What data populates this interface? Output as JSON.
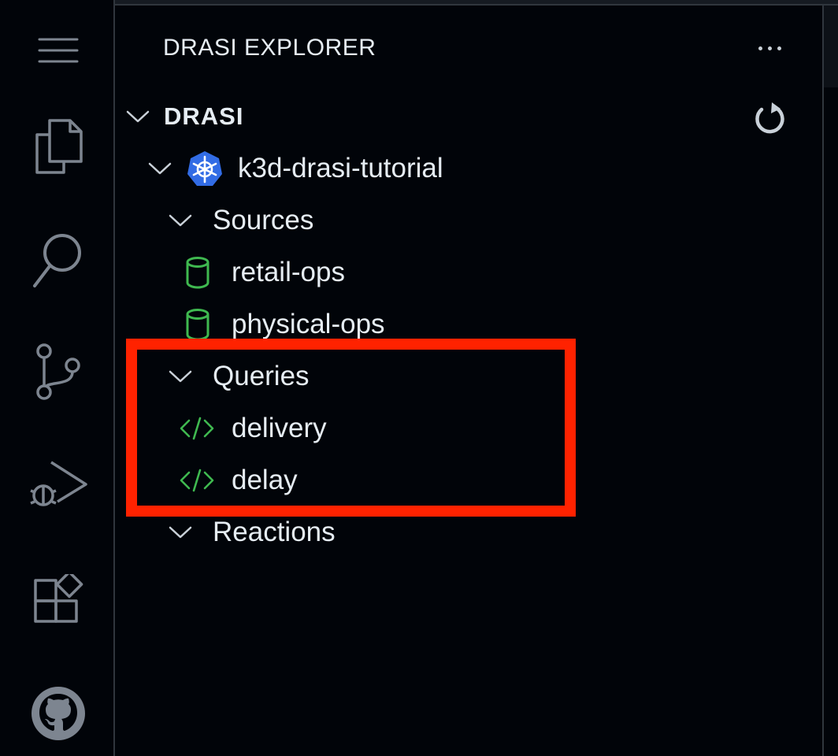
{
  "explorer": {
    "title": "DRASI EXPLORER",
    "more_icon": "ellipsis-icon",
    "section": {
      "label": "DRASI",
      "refresh_icon": "refresh-icon"
    },
    "cluster": {
      "label": "k3d-drasi-tutorial",
      "icon": "kubernetes-icon"
    },
    "groups": {
      "sources": {
        "label": "Sources",
        "items": [
          {
            "label": "retail-ops",
            "icon": "database-icon"
          },
          {
            "label": "physical-ops",
            "icon": "database-icon"
          }
        ]
      },
      "queries": {
        "label": "Queries",
        "items": [
          {
            "label": "delivery",
            "icon": "code-icon"
          },
          {
            "label": "delay",
            "icon": "code-icon"
          }
        ]
      },
      "reactions": {
        "label": "Reactions"
      }
    }
  },
  "activity_bar": [
    "menu-icon",
    "explorer-files-icon",
    "search-icon",
    "source-control-icon",
    "run-debug-icon",
    "extensions-icon",
    "github-icon"
  ],
  "colors": {
    "background": "#010409",
    "text": "#e6edf3",
    "icon_muted": "#7d8590",
    "source_icon": "#3fb950",
    "highlight": "#ff2200",
    "kubernetes": "#326ce5"
  }
}
